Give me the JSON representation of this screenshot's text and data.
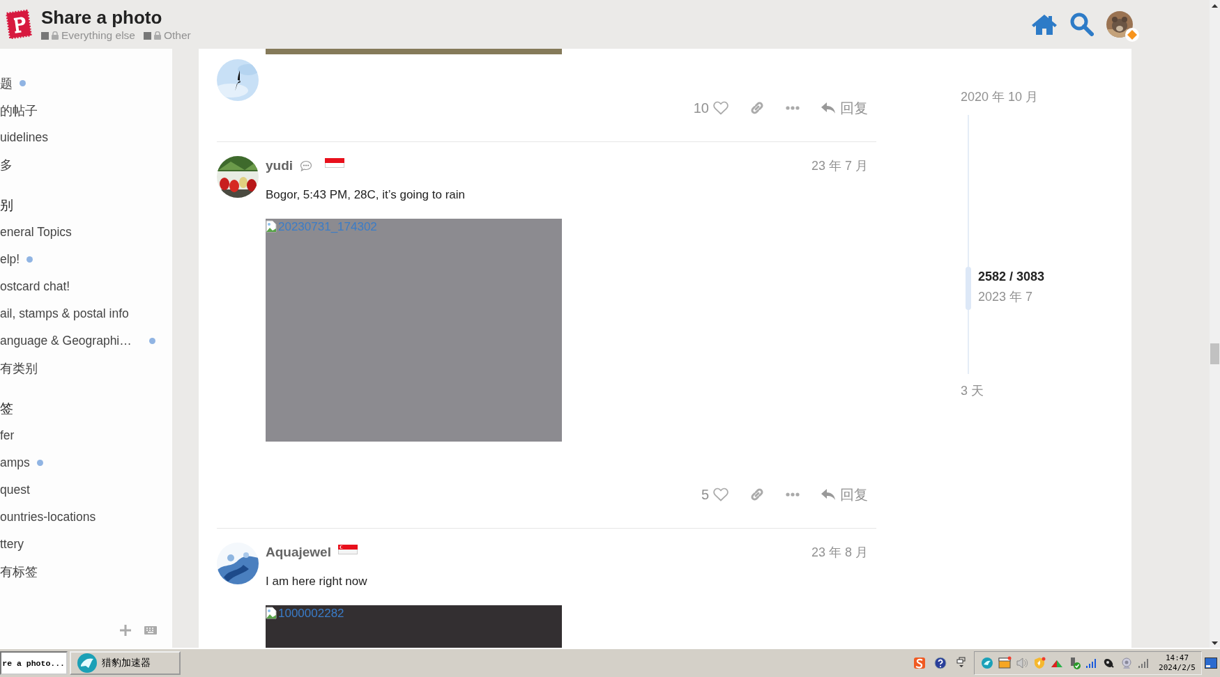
{
  "header": {
    "title": "Share a photo",
    "categories": [
      {
        "label": "Everything else",
        "locked": true
      },
      {
        "label": "Other",
        "locked": true
      }
    ]
  },
  "sidebar": {
    "items": [
      {
        "kind": "link",
        "label": "题",
        "unread": true
      },
      {
        "kind": "link",
        "label": "的帖子",
        "unread": false
      },
      {
        "kind": "link",
        "label": "uidelines",
        "unread": false
      },
      {
        "kind": "link",
        "label": "多",
        "unread": false
      },
      {
        "kind": "heading",
        "label": "别",
        "unread": false
      },
      {
        "kind": "link",
        "label": "eneral Topics",
        "unread": false
      },
      {
        "kind": "link",
        "label": "elp!",
        "unread": true
      },
      {
        "kind": "link",
        "label": "ostcard chat!",
        "unread": false
      },
      {
        "kind": "link",
        "label": "ail, stamps & postal info",
        "unread": false
      },
      {
        "kind": "link",
        "label": "anguage & Geographi…",
        "unread": true
      },
      {
        "kind": "link",
        "label": "有类别",
        "unread": false
      },
      {
        "kind": "heading",
        "label": "签",
        "unread": false
      },
      {
        "kind": "link",
        "label": "fer",
        "unread": false
      },
      {
        "kind": "link",
        "label": "amps",
        "unread": true
      },
      {
        "kind": "link",
        "label": "quest",
        "unread": false
      },
      {
        "kind": "link",
        "label": "ountries-locations",
        "unread": false
      },
      {
        "kind": "link",
        "label": "ttery",
        "unread": false
      },
      {
        "kind": "link",
        "label": "有标签",
        "unread": false
      }
    ]
  },
  "posts": [
    {
      "kind": "continued",
      "likes": "10",
      "reply_label": "回复"
    },
    {
      "kind": "full",
      "username": "yudi",
      "user_status": true,
      "date": "23 年 7 月",
      "text": "Bogor, 5:43 PM, 28C, it’s going to rain",
      "image": {
        "alt": "20230731_174302",
        "color": "#8c8b90"
      },
      "likes": "5",
      "reply_label": "回复"
    },
    {
      "kind": "full",
      "username": "Aquajewel",
      "user_status": false,
      "date": "23 年 8 月",
      "text": "I am here right now",
      "image": {
        "alt": "1000002282",
        "color": "#332f31"
      }
    }
  ],
  "timeline": {
    "start": "2020 年 10 月",
    "position": "2582 / 3083",
    "position_date": "2023 年 7",
    "end": "3 天"
  },
  "taskbar": {
    "windows": [
      {
        "kind": "browser",
        "label": "re a photo...",
        "selected": true
      },
      {
        "kind": "app",
        "label": "猎豹加速器",
        "selected": false
      }
    ],
    "time": "14:47",
    "date": "2024/2/5"
  }
}
